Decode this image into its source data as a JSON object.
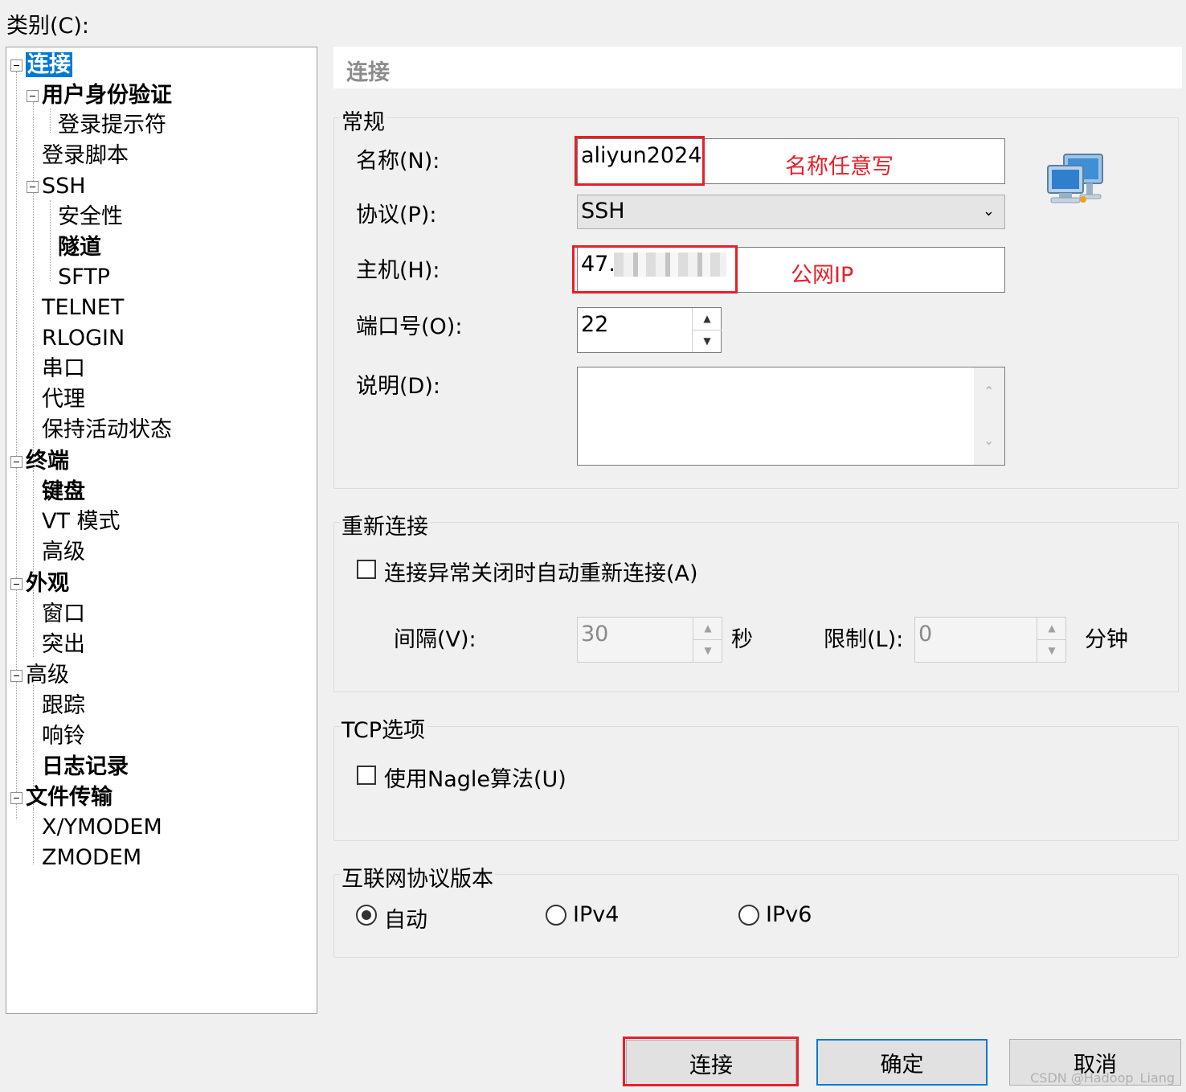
{
  "category_label": "类别(C):",
  "tree": [
    {
      "label": "连接",
      "selected": true,
      "bold": true
    },
    {
      "label": "用户身份验证",
      "bold": true
    },
    {
      "label": "登录提示符"
    },
    {
      "label": "登录脚本"
    },
    {
      "label": "SSH"
    },
    {
      "label": "安全性"
    },
    {
      "label": "隧道",
      "bold": true
    },
    {
      "label": "SFTP"
    },
    {
      "label": "TELNET"
    },
    {
      "label": "RLOGIN"
    },
    {
      "label": "串口"
    },
    {
      "label": "代理"
    },
    {
      "label": "保持活动状态"
    },
    {
      "label": "终端",
      "bold": true
    },
    {
      "label": "键盘",
      "bold": true
    },
    {
      "label": "VT 模式"
    },
    {
      "label": "高级"
    },
    {
      "label": "外观",
      "bold": true
    },
    {
      "label": "窗口"
    },
    {
      "label": "突出"
    },
    {
      "label": "高级"
    },
    {
      "label": "跟踪"
    },
    {
      "label": "响铃"
    },
    {
      "label": "日志记录",
      "bold": true
    },
    {
      "label": "文件传输",
      "bold": true
    },
    {
      "label": "X/YMODEM"
    },
    {
      "label": "ZMODEM"
    }
  ],
  "header": {
    "title": "连接"
  },
  "general": {
    "title": "常规",
    "name_label": "名称(N):",
    "name_value": "aliyun2024",
    "name_annotation": "名称任意写",
    "protocol_label": "协议(P):",
    "protocol_value": "SSH",
    "host_label": "主机(H):",
    "host_value": "47.",
    "host_annotation": "公网IP",
    "port_label": "端口号(O):",
    "port_value": "22",
    "desc_label": "说明(D):",
    "desc_value": ""
  },
  "reconnect": {
    "title": "重新连接",
    "auto_label": "连接异常关闭时自动重新连接(A)",
    "interval_label": "间隔(V):",
    "interval_value": "30",
    "interval_unit": "秒",
    "limit_label": "限制(L):",
    "limit_value": "0",
    "limit_unit": "分钟"
  },
  "tcp": {
    "title": "TCP选项",
    "nagle_label": "使用Nagle算法(U)"
  },
  "ip": {
    "title": "互联网协议版本",
    "options": [
      "自动",
      "IPv4",
      "IPv6"
    ],
    "selected": "自动"
  },
  "buttons": {
    "connect": "连接",
    "ok": "确定",
    "cancel": "取消"
  },
  "watermark": "CSDN @Hadoop_Liang",
  "colors": {
    "annotation": "#e6202b",
    "selection": "#0078d7"
  }
}
